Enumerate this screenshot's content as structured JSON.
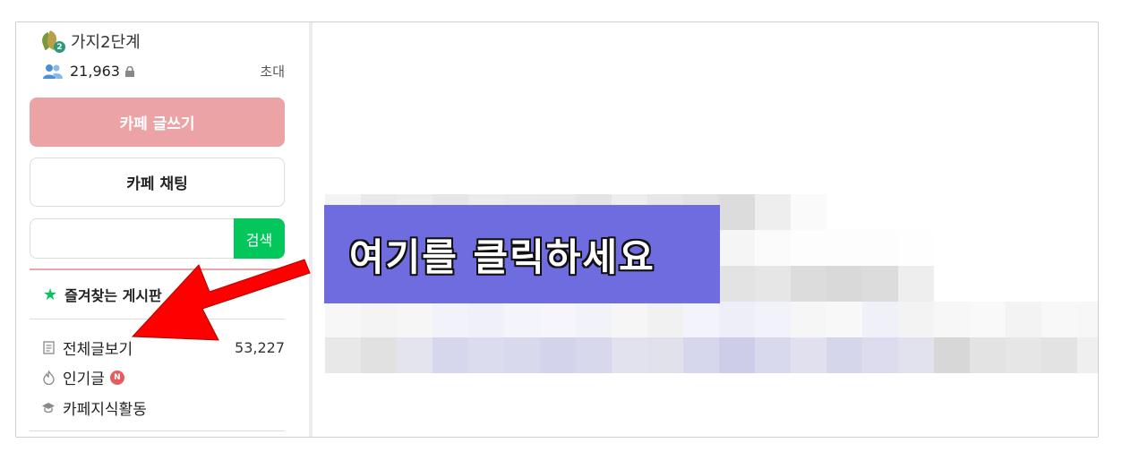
{
  "cafe": {
    "level_name": "가지2단계",
    "level_badge": "2",
    "member_count": "21,963",
    "invite_label": "초대"
  },
  "buttons": {
    "write_label": "카페 글쓰기",
    "chat_label": "카페 채팅"
  },
  "search": {
    "value": "",
    "button_label": "검색"
  },
  "favorites": {
    "label": "즐겨찾는 게시판"
  },
  "menu": [
    {
      "label": "전체글보기",
      "count": "53,227",
      "icon": "document-icon"
    },
    {
      "label": "인기글",
      "badge": "N",
      "icon": "flame-icon"
    },
    {
      "label": "카페지식활동",
      "icon": "graduation-cap-icon"
    }
  ],
  "overlay": {
    "callout_text": "여기를 클릭하세요",
    "callout_bg": "#6f6ce0",
    "arrow_color": "#ff0000"
  },
  "colors": {
    "write_button": "#eba3a6",
    "search_button": "#03c75a",
    "star": "#03c75a",
    "new_badge": "#e45c5c"
  }
}
